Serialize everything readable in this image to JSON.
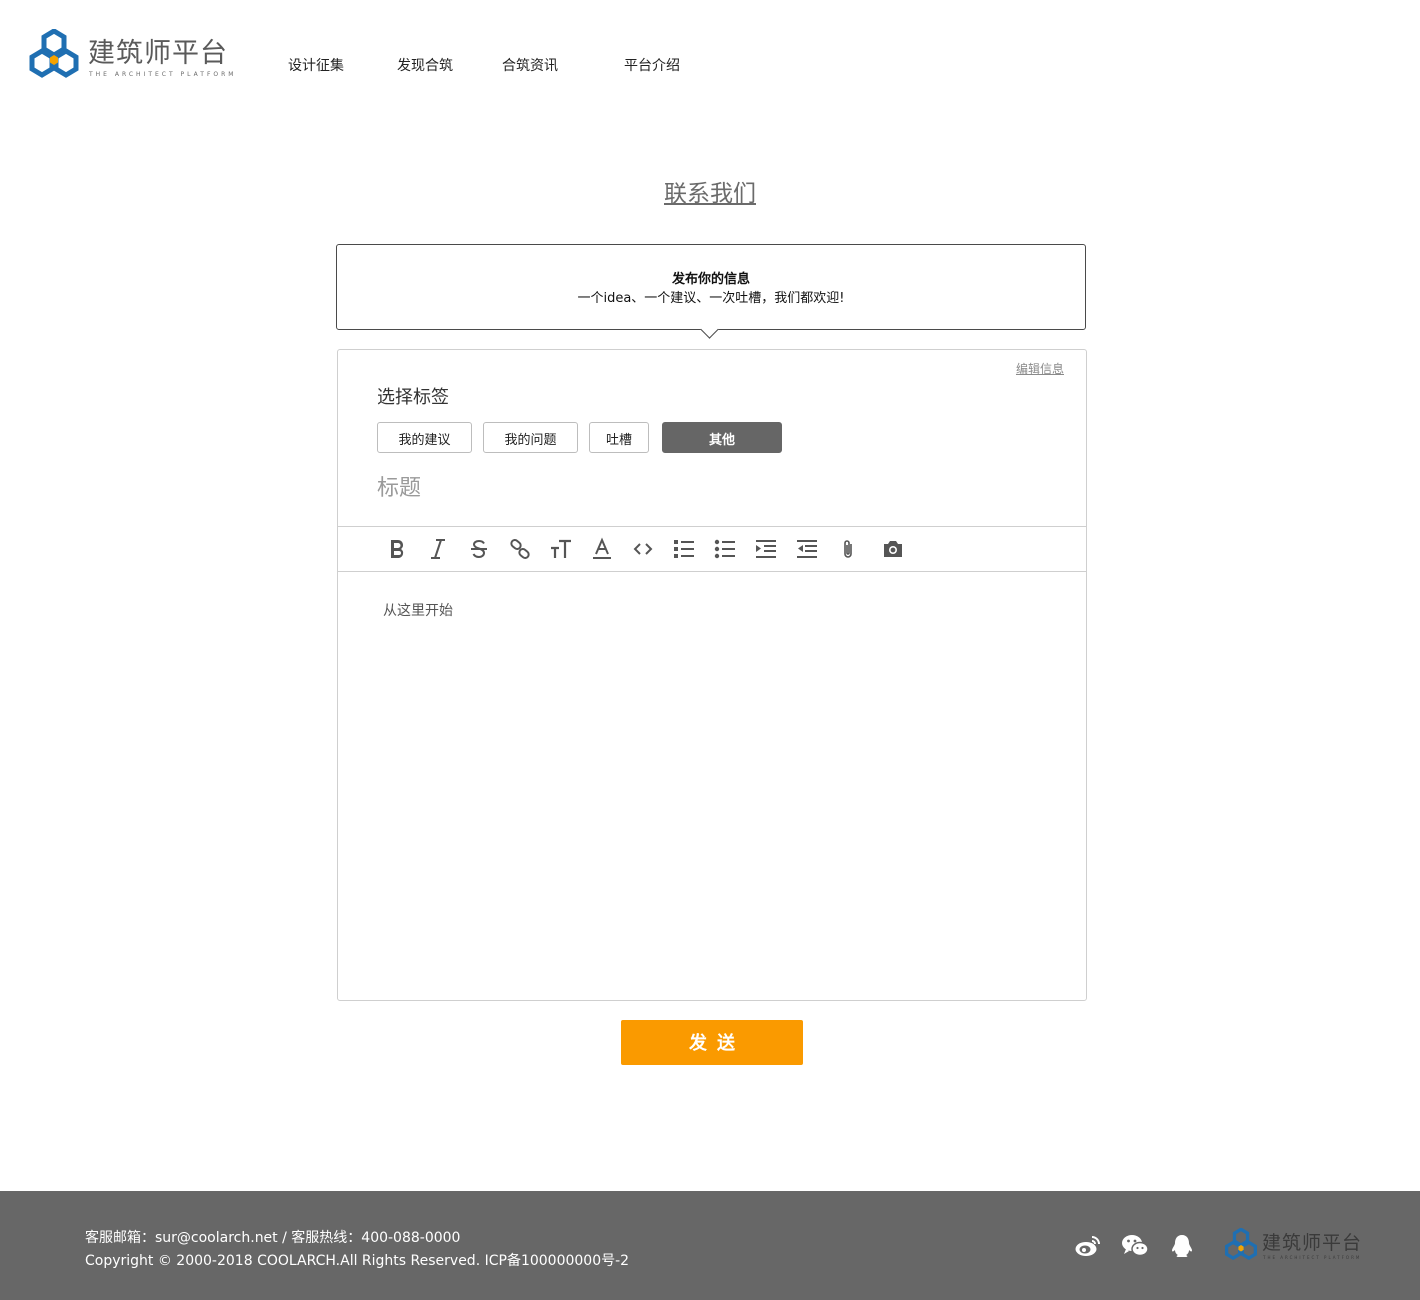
{
  "header": {
    "logo_text": "建筑师平台",
    "logo_subtext": "THE ARCHITECT PLATFORM",
    "nav": [
      "设计征集",
      "发现合筑",
      "合筑资讯",
      "平台介绍"
    ]
  },
  "page": {
    "title": "联系我们"
  },
  "notice": {
    "heading": "发布你的信息",
    "subtext": "一个idea、一个建议、一次吐槽，我们都欢迎!"
  },
  "form": {
    "edit_link": "编辑信息",
    "tag_label": "选择标签",
    "tags": [
      "我的建议",
      "我的问题",
      "吐槽",
      "其他"
    ],
    "selected_tag": "其他",
    "title_placeholder": "标题",
    "toolbar_icons": [
      "bold-icon",
      "italic-icon",
      "strikethrough-icon",
      "link-icon",
      "text-size-icon",
      "text-color-icon",
      "code-icon",
      "ordered-list-icon",
      "unordered-list-icon",
      "indent-icon",
      "outdent-icon",
      "attachment-icon",
      "camera-icon"
    ],
    "editor_placeholder": "从这里开始",
    "send_label": "发送"
  },
  "footer": {
    "contact": "客服邮箱：sur@coolarch.net / 客服热线：400-088-0000",
    "copyright": "Copyright © 2000-2018 COOLARCH.All Rights Reserved.  ICP备100000000号-2",
    "social_icons": [
      "weibo-icon",
      "wechat-icon",
      "qq-icon"
    ],
    "logo_text": "建筑师平台",
    "logo_subtext": "THE ARCHITECT PLATFORM"
  },
  "colors": {
    "accent": "#fa9a00",
    "brand_blue": "#1f6fb2",
    "tag_active": "#666666",
    "footer_bg": "#676767"
  }
}
